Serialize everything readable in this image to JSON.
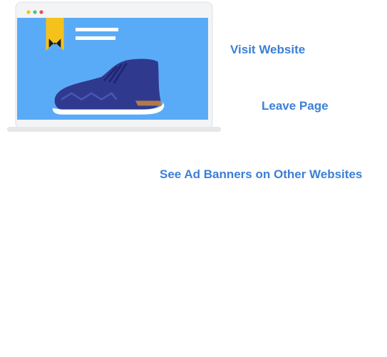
{
  "steps": {
    "visit": "Visit Website",
    "leave": "Leave Page",
    "retarget": "See Ad Banners on Other Websites"
  },
  "colors": {
    "label_blue": "#3b7fd6",
    "arrow_red": "#e8464b",
    "screen_blue": "#5aabf7",
    "shoe_navy": "#2f3a8f",
    "ribbon_yellow": "#f5c21b",
    "close_red": "#ef4d5a",
    "device_gray": "#e6e7e9",
    "content_gray": "#d6d8db"
  },
  "icons": [
    "browser-dots-icon",
    "bookmark-ribbon-icon",
    "sneaker-icon",
    "close-icon",
    "dashed-arrow-icon"
  ]
}
